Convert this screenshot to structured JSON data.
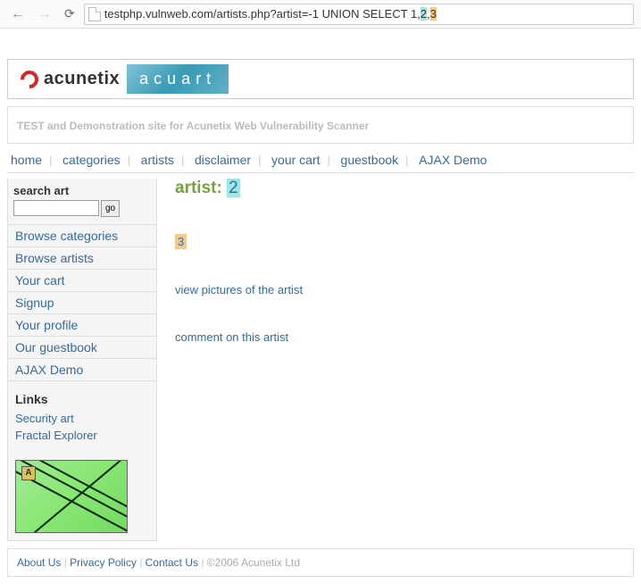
{
  "url": {
    "base": "testphp.vulnweb.com/artists.php?artist=-1 UNION SELECT 1, ",
    "seg2": "2",
    "sep": ", ",
    "seg3": "3"
  },
  "logo": {
    "brand": "acunetix",
    "sub": "acuart"
  },
  "site_desc": "TEST and Demonstration site for Acunetix Web Vulnerability Scanner",
  "nav": {
    "home": "home",
    "categories": "categories",
    "artists": "artists",
    "disclaimer": "disclaimer",
    "cart": "your cart",
    "guestbook": "guestbook",
    "ajax": "AJAX Demo"
  },
  "sidebar": {
    "search_title": "search art",
    "go": "go",
    "links": {
      "browse_categories": "Browse categories",
      "browse_artists": "Browse artists",
      "your_cart": "Your cart",
      "signup": "Signup",
      "your_profile": "Your profile",
      "guestbook": "Our guestbook",
      "ajax": "AJAX Demo"
    },
    "links_title": "Links",
    "ext": {
      "security_art": "Security art",
      "fractal": "Fractal Explorer"
    },
    "thumb_btn": "A"
  },
  "content": {
    "artist_label": "artist: ",
    "artist_value": "2",
    "body_value": "3",
    "view_pictures": "view pictures of the artist",
    "comment": "comment on this artist"
  },
  "footer": {
    "about": "About Us",
    "privacy": "Privacy Policy",
    "contact": "Contact Us",
    "copy": "©2006 Acunetix Ltd"
  }
}
